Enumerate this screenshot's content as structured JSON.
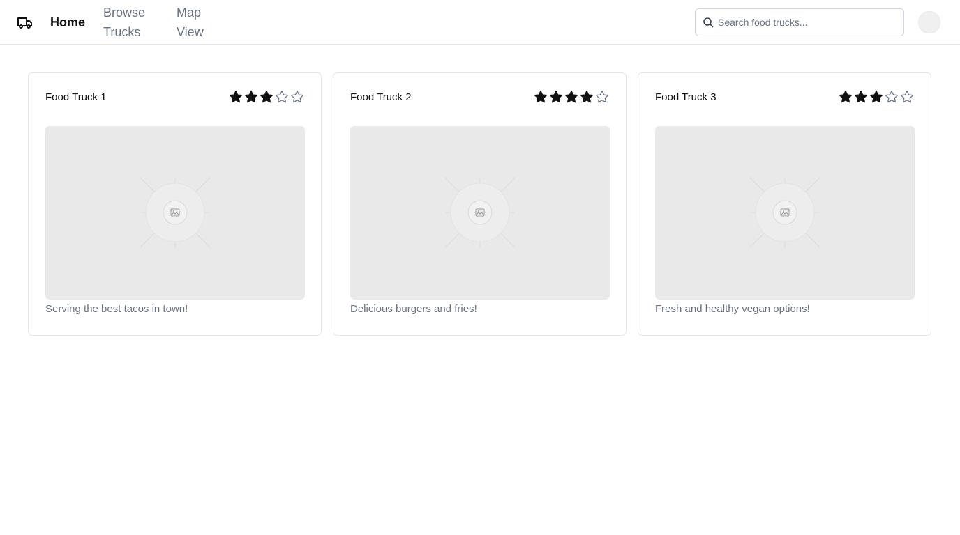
{
  "header": {
    "logo_icon": "truck-icon",
    "nav": {
      "home": "Home",
      "browse_line1": "Browse",
      "browse_line2": "Trucks",
      "map_line1": "Map",
      "map_line2": "View"
    },
    "search": {
      "placeholder": "Search food trucks...",
      "value": "",
      "icon": "search-icon"
    },
    "avatar_icon": "avatar"
  },
  "trucks": [
    {
      "name": "Food Truck 1",
      "rating": 3,
      "max_rating": 5,
      "image_icon": "image-placeholder-icon",
      "description": "Serving the best tacos in town!"
    },
    {
      "name": "Food Truck 2",
      "rating": 4,
      "max_rating": 5,
      "image_icon": "image-placeholder-icon",
      "description": "Delicious burgers and fries!"
    },
    {
      "name": "Food Truck 3",
      "rating": 3,
      "max_rating": 5,
      "image_icon": "image-placeholder-icon",
      "description": "Fresh and healthy vegan options!"
    }
  ],
  "colors": {
    "text_primary": "#111111",
    "text_muted": "#6b7280",
    "border": "#e5e7eb",
    "star_filled": "#111111",
    "star_empty": "#6b7280",
    "placeholder_bg": "#e9e9e9"
  }
}
